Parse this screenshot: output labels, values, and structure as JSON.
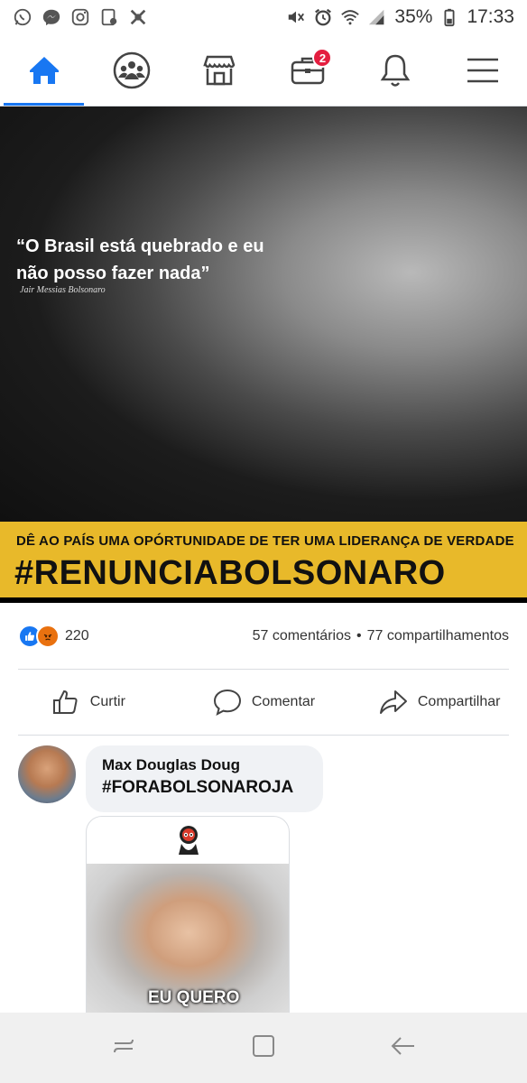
{
  "status_bar": {
    "battery": "35%",
    "time": "17:33",
    "left_icons": [
      "whatsapp-icon",
      "messenger-icon",
      "instagram-icon",
      "media-icon",
      "app-icon"
    ],
    "right_icons": [
      "mute-icon",
      "alarm-icon",
      "wifi-icon",
      "signal-icon",
      "battery-icon"
    ]
  },
  "fb_nav": {
    "tabs": [
      {
        "name": "home",
        "active": true
      },
      {
        "name": "groups",
        "active": false
      },
      {
        "name": "marketplace",
        "active": false
      },
      {
        "name": "jobs",
        "active": false,
        "badge": "2"
      },
      {
        "name": "notifications",
        "active": false
      },
      {
        "name": "menu",
        "active": false
      }
    ],
    "accent": "#1877f2"
  },
  "post": {
    "quote": "“O Brasil está quebrado e eu não posso fazer nada”",
    "quote_author": "Jair Messias Bolsonaro",
    "banner_line1": "DÊ AO PAÍS UMA OPÓRTUNIDADE DE TER UMA LIDERANÇA DE VERDADE",
    "banner_line2": "#RENUNCIABOLSONARO",
    "banner_color": "#e8b92a"
  },
  "reactions": {
    "count": "220",
    "comments": "57 comentários",
    "separator": "•",
    "shares": "77 compartilhamentos"
  },
  "actions": {
    "like": "Curtir",
    "comment": "Comentar",
    "share": "Compartilhar"
  },
  "comment": {
    "author": "Max Douglas Doug",
    "text": "#FORABOLSONAROJA",
    "sticker_caption": "EU QUERO"
  }
}
